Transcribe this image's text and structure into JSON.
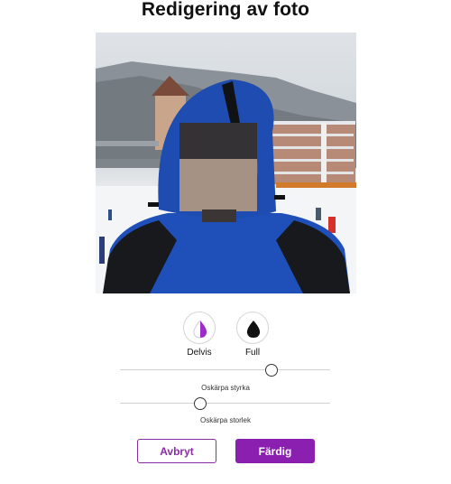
{
  "header": {
    "title": "Redigering av foto"
  },
  "blur_modes": [
    {
      "label": "Delvis",
      "icon": "half-drop-icon",
      "selected": true
    },
    {
      "label": "Full",
      "icon": "drop-icon",
      "selected": false
    }
  ],
  "sliders": {
    "strength": {
      "label": "Oskärpa styrka",
      "value": 0.72
    },
    "size": {
      "label": "Oskärpa storlek",
      "value": 0.38
    }
  },
  "actions": {
    "cancel_label": "Avbryt",
    "done_label": "Färdig"
  },
  "colors": {
    "accent": "#8a1fb0"
  }
}
